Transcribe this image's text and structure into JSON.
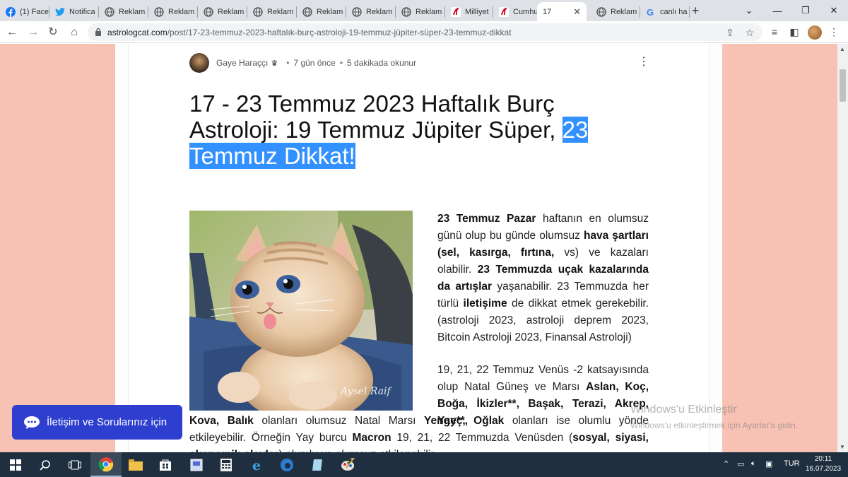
{
  "browser": {
    "tabs": [
      {
        "label": "(1) Face",
        "icon": "facebook-icon"
      },
      {
        "label": "Notifica",
        "icon": "twitter-icon"
      },
      {
        "label": "Reklam",
        "icon": "globe-icon"
      },
      {
        "label": "Reklam",
        "icon": "globe-icon"
      },
      {
        "label": "Reklam",
        "icon": "globe-icon"
      },
      {
        "label": "Reklam",
        "icon": "globe-icon"
      },
      {
        "label": "Reklam",
        "icon": "globe-icon"
      },
      {
        "label": "Reklam",
        "icon": "globe-icon"
      },
      {
        "label": "Reklam",
        "icon": "globe-icon"
      },
      {
        "label": "Milliyet",
        "icon": "milliyet-icon"
      },
      {
        "label": "Cumhu",
        "icon": "cumhuriyet-icon"
      },
      {
        "label": "17",
        "icon": "",
        "active": true
      },
      {
        "label": "Reklam",
        "icon": "globe-icon"
      },
      {
        "label": "canlı ha",
        "icon": "google-icon"
      }
    ],
    "close_glyph": "✕",
    "new_tab_glyph": "+",
    "address": {
      "host": "astrologcat.com",
      "path": "/post/17-23-temmuz-2023-haftalık-burç-astroloji-19-temmuz-jüpiter-süper-23-temmuz-dikkat"
    }
  },
  "post": {
    "author": "Gaye Haraççı",
    "posted": "7 gün önce",
    "dot": "•",
    "read_time": "5 dakikada okunur",
    "title_main": "17 - 23 Temmuz 2023 Haftalık Burç Astroloji: 19 Temmuz Jüpiter Süper, ",
    "title_highlight": "23 Temmuz Dikkat!",
    "image_signature": "Aysel Raif",
    "p1": [
      {
        "t": "23 Temmuz Pazar",
        "b": true
      },
      {
        "t": " haftanın en olumsuz günü olup bu günde olumsuz ",
        "b": false
      },
      {
        "t": "hava şartları (sel, kasırga, fırtına,",
        "b": true
      },
      {
        "t": " vs) ve kazaları olabilir. ",
        "b": false
      },
      {
        "t": "23 Temmuzda uçak kazalarında da artışlar",
        "b": true
      },
      {
        "t": " yaşanabilir. 23 Temmuzda her türlü ",
        "b": false
      },
      {
        "t": "iletişime",
        "b": true
      },
      {
        "t": " de dikkat etmek gerekebilir. (astroloji 2023, astroloji deprem 2023, Bitcoin Astroloji 2023, Finansal Astroloji)",
        "b": false
      }
    ],
    "p2": [
      {
        "t": "19, 21, 22 Temmuz Venüs -2 katsayısında olup Natal Güneş ve Marsı ",
        "b": false
      },
      {
        "t": "Aslan, Koç, Boğa, İkizler**, Başak, Terazi, Akrep, Yay**,",
        "b": true
      }
    ],
    "p2b": [
      {
        "t": "Kova, Balık",
        "b": true
      },
      {
        "t": " olanları olumsuz Natal Marsı ",
        "b": false
      },
      {
        "t": "Yengeç, Oğlak",
        "b": true
      },
      {
        "t": " olanları ise olumlu yönde etkileyebilir. Örneğin Yay burcu ",
        "b": false
      },
      {
        "t": "Macron",
        "b": true
      },
      {
        "t": " 19, 21, 22 Temmuzda Venüsden (",
        "b": false
      },
      {
        "t": "sosyal, siyasi, ekonomik olaylar",
        "b": true
      },
      {
        "t": ") olumlu ve olumsuz etkilenebilir.",
        "b": false
      }
    ]
  },
  "chat_button": {
    "label": "İletişim ve Sorularınız için"
  },
  "watermark": {
    "line1": "Windows'u Etkinleştir",
    "line2": "Windows'u etkinleştirmek için Ayarlar'a gidin."
  },
  "taskbar": {
    "lang": "TUR",
    "time": "20:11",
    "date": "16.07.2023"
  },
  "colors": {
    "page_bg": "#f7c2b3",
    "highlight": "#3390ff",
    "chat": "#2e3fd0",
    "taskbar": "#1f2f3f"
  }
}
